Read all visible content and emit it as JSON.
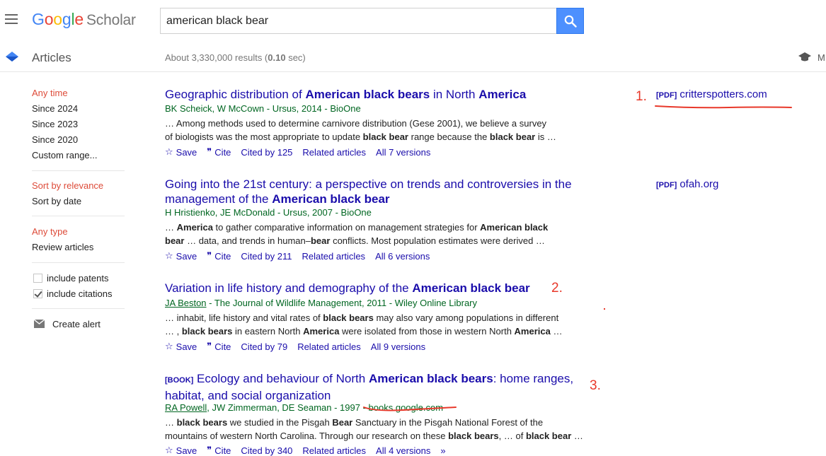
{
  "header": {
    "logo_google": "Google",
    "logo_scholar": "Scholar",
    "search_value": "american black bear"
  },
  "subheader": {
    "section": "Articles",
    "results_prefix": "About 3,330,000 results (",
    "results_time": "0.10",
    "results_suffix": " sec)",
    "my_profile": "M"
  },
  "sidebar": {
    "time_heading": "Any time",
    "time_options": [
      "Since 2024",
      "Since 2023",
      "Since 2020",
      "Custom range..."
    ],
    "sort_heading": "Sort by relevance",
    "sort_date": "Sort by date",
    "type_heading": "Any type",
    "type_review": "Review articles",
    "include_patents": "include patents",
    "include_citations": "include citations",
    "create_alert": "Create alert"
  },
  "results": [
    {
      "title_html": "Geographic distribution of <b>American black bears</b> in North <b>America</b>",
      "meta": "BK Scheick, W McCown - Ursus, 2014 - BioOne",
      "snippet_html": "… Among methods used to determine carnivore distribution (Gese 2001), we believe a survey<br>of biologists was the most appropriate to update <b>black bear</b> range because the <b>black bear</b> is …",
      "cited": "Cited by 125",
      "versions": "All 7 versions",
      "side_pdf": "[PDF]",
      "side_domain": "critterspotters.com"
    },
    {
      "title_html": "Going into the 21st century: a perspective on trends and controversies in the<br>management of the <b>American black bear</b>",
      "meta": "H Hristienko, JE McDonald - Ursus, 2007 - BioOne",
      "snippet_html": "… <b>America</b> to gather comparative information on management strategies for <b>American black</b><br><b>bear</b> … data, and trends in human–<b>bear</b> conflicts. Most population estimates were derived …",
      "cited": "Cited by 211",
      "versions": "All 6 versions",
      "side_pdf": "[PDF]",
      "side_domain": "ofah.org"
    },
    {
      "title_html": "Variation in life history and demography of the <b>American black bear</b>",
      "meta_link": "JA Beston",
      "meta_rest": " - The Journal of Wildlife Management, 2011 - Wiley Online Library",
      "snippet_html": "… inhabit, life history and vital rates of <b>black bears</b> may also vary among populations in different<br>… , <b>black bears</b> in eastern North <b>America</b> were isolated from those in western North <b>America</b> …",
      "cited": "Cited by 79",
      "versions": "All 9 versions"
    },
    {
      "title_html": "<span class=\"tag\">[BOOK]</span> Ecology and behaviour of North <b>American black bears</b>: home ranges,<br>habitat, and social organization",
      "meta_link": "RA Powell",
      "meta_rest": ", JW Zimmerman, DE Seaman - 1997 - books.google.com",
      "snippet_html": "… <b>black bears</b> we studied in the Pisgah <b>Bear</b> Sanctuary in the Pisgah National Forest of the<br>mountains of western North Carolina. Through our research on these <b>black bears</b>, … of <b>black bear</b> …",
      "cited": "Cited by 340",
      "versions": "All 4 versions"
    }
  ],
  "actions": {
    "save": "Save",
    "cite": "Cite",
    "related": "Related articles"
  },
  "annotations": [
    "1.",
    "2.",
    "3."
  ],
  "colors": {
    "link": "#1a0dab",
    "meta_green": "#006621",
    "sidebar_red": "#dd4b39",
    "annotation_red": "#e8382a",
    "search_button": "#4d90fe"
  }
}
